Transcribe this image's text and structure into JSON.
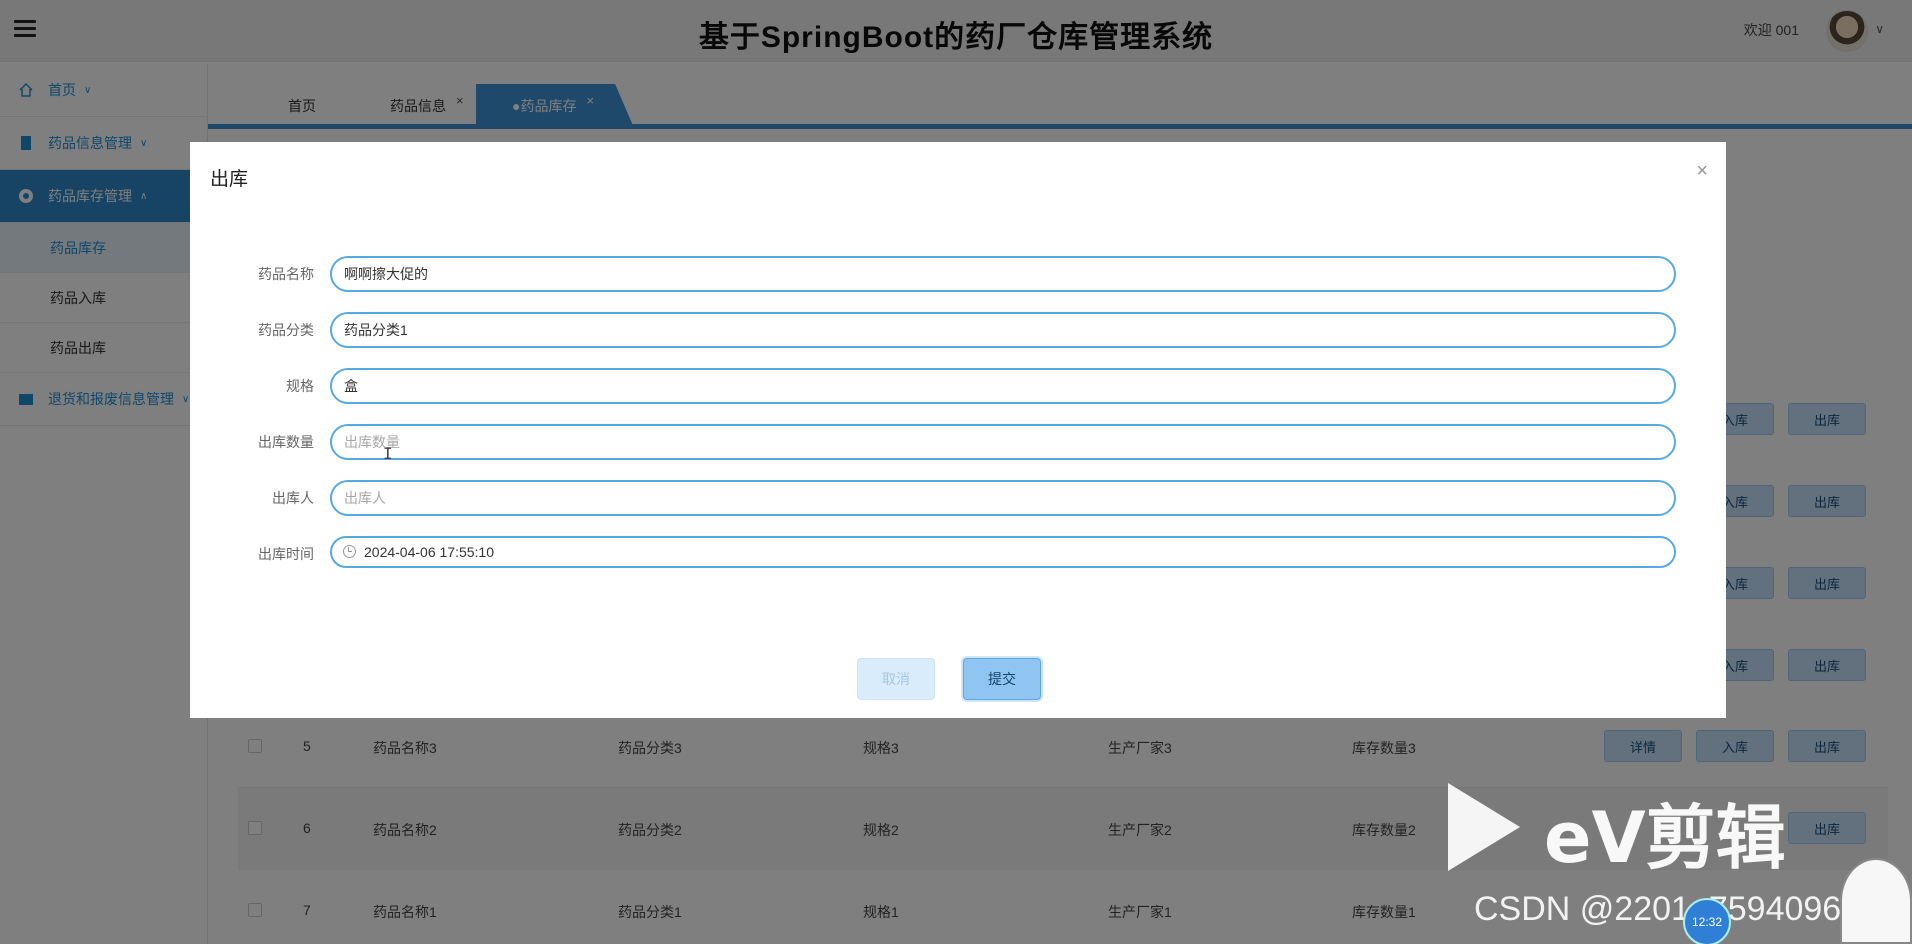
{
  "header": {
    "title": "基于SpringBoot的药厂仓库管理系统",
    "welcome": "欢迎 001"
  },
  "sidebar": {
    "items": [
      {
        "label": "首页",
        "icon": "home-icon"
      },
      {
        "label": "药品信息管理",
        "icon": "book-icon"
      },
      {
        "label": "药品库存管理",
        "icon": "circle-icon"
      },
      {
        "label": "退货和报废信息管理",
        "icon": "folder-icon"
      }
    ],
    "sub_items": [
      "药品库存",
      "药品入库",
      "药品出库"
    ]
  },
  "tabs": [
    {
      "label": "首页"
    },
    {
      "label": "药品信息"
    },
    {
      "label": "●药品库存"
    }
  ],
  "table": {
    "buttons": {
      "detail": "详情",
      "in": "入库",
      "out": "出库"
    },
    "rows": [
      {
        "no": "5",
        "name": "药品名称3",
        "category": "药品分类3",
        "spec": "规格3",
        "maker": "生产厂家3",
        "stock": "库存数量3"
      },
      {
        "no": "6",
        "name": "药品名称2",
        "category": "药品分类2",
        "spec": "规格2",
        "maker": "生产厂家2",
        "stock": "库存数量2"
      },
      {
        "no": "7",
        "name": "药品名称1",
        "category": "药品分类1",
        "spec": "规格1",
        "maker": "生产厂家1",
        "stock": "库存数量1"
      }
    ]
  },
  "dialog": {
    "title": "出库",
    "fields": [
      {
        "label": "药品名称",
        "value": "啊啊擦大促的",
        "placeholder": ""
      },
      {
        "label": "药品分类",
        "value": "药品分类1",
        "placeholder": ""
      },
      {
        "label": "规格",
        "value": "盒",
        "placeholder": ""
      },
      {
        "label": "出库数量",
        "value": "",
        "placeholder": "出库数量"
      },
      {
        "label": "出库人",
        "value": "",
        "placeholder": "出库人"
      },
      {
        "label": "出库时间",
        "value": "2024-04-06 17:55:10",
        "placeholder": ""
      }
    ],
    "cancel": "取消",
    "submit": "提交"
  },
  "watermark": {
    "brand": "eV剪辑",
    "csdn": "CSDN @2201_75940964",
    "timer": "12:32"
  }
}
